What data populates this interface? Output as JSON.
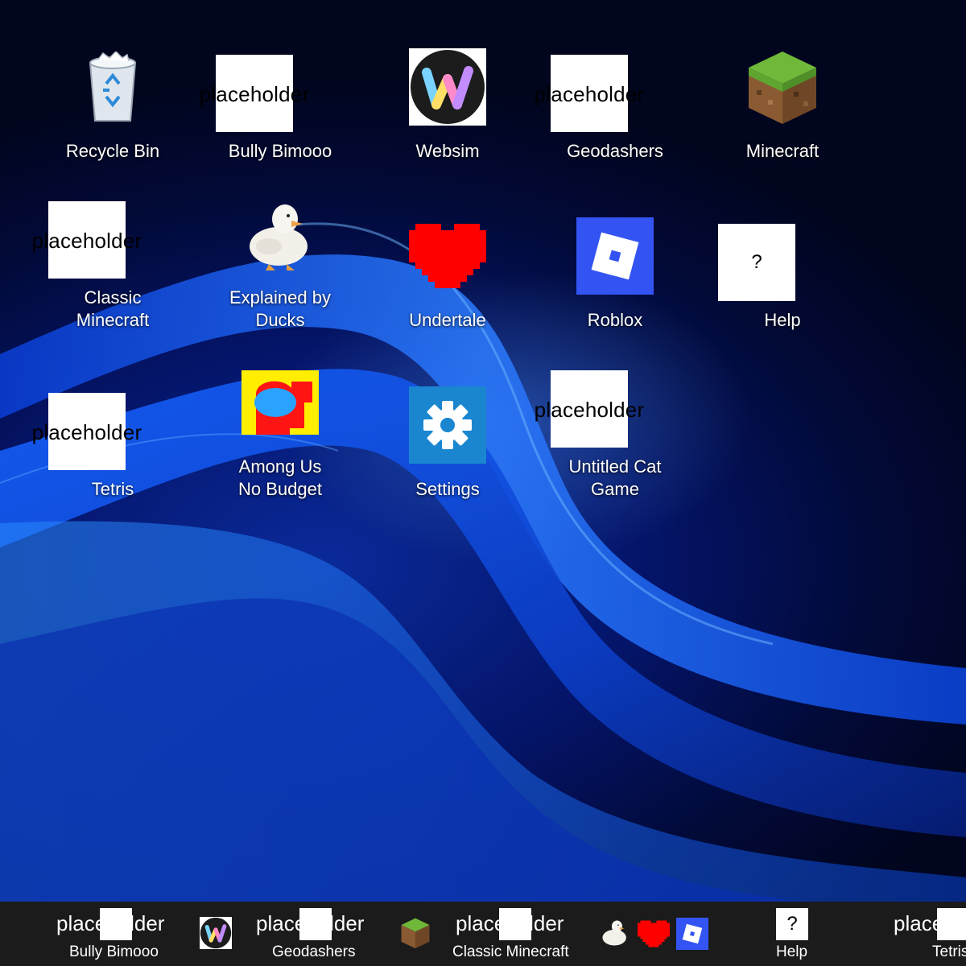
{
  "desktop": {
    "icons": [
      {
        "label": "Recycle Bin",
        "icon": "recycle-bin-icon"
      },
      {
        "label": "Bully Bimooo",
        "icon": "placeholder-image",
        "placeholder": "placeholder"
      },
      {
        "label": "Websim",
        "icon": "websim-icon"
      },
      {
        "label": "Geodashers",
        "icon": "placeholder-image",
        "placeholder": "placeholder"
      },
      {
        "label": "Minecraft",
        "icon": "minecraft-grass-block-icon"
      },
      {
        "label_line1": "Classic",
        "label_line2": "Minecraft",
        "icon": "placeholder-image",
        "placeholder": "placeholder"
      },
      {
        "label_line1": "Explained by",
        "label_line2": "Ducks",
        "icon": "duck-icon"
      },
      {
        "label": "Undertale",
        "icon": "red-heart-icon"
      },
      {
        "label": "Roblox",
        "icon": "roblox-icon"
      },
      {
        "label": "Help",
        "icon": "help-icon",
        "glyph": "?"
      },
      {
        "label": "Tetris",
        "icon": "placeholder-image",
        "placeholder": "placeholder"
      },
      {
        "label_line1": "Among Us",
        "label_line2": "No Budget",
        "icon": "among-us-icon"
      },
      {
        "label": "Settings",
        "icon": "gear-icon"
      },
      {
        "label_line1": "Untitled Cat",
        "label_line2": "Game",
        "icon": "placeholder-image",
        "placeholder": "placeholder"
      }
    ]
  },
  "taskbar": {
    "items": [
      {
        "label": "Bully Bimooo",
        "placeholder": "placeholder"
      },
      {
        "icon": "websim-icon"
      },
      {
        "label": "Geodashers",
        "placeholder": "placeholder"
      },
      {
        "icon": "minecraft-grass-block-icon"
      },
      {
        "label": "Classic Minecraft",
        "placeholder": "placeholder"
      },
      {
        "icon": "duck-icon"
      },
      {
        "icon": "red-heart-icon"
      },
      {
        "icon": "roblox-icon"
      },
      {
        "label": "Help",
        "glyph": "?"
      },
      {
        "label": "Tetris",
        "placeholder": "placeholder"
      }
    ]
  },
  "colors": {
    "taskbar_bg": "#1b1b1b",
    "roblox_blue": "#3354f2",
    "settings_blue": "#1a86d0",
    "undertale_red": "#ff0000",
    "among_us_yellow": "#ffee00"
  }
}
